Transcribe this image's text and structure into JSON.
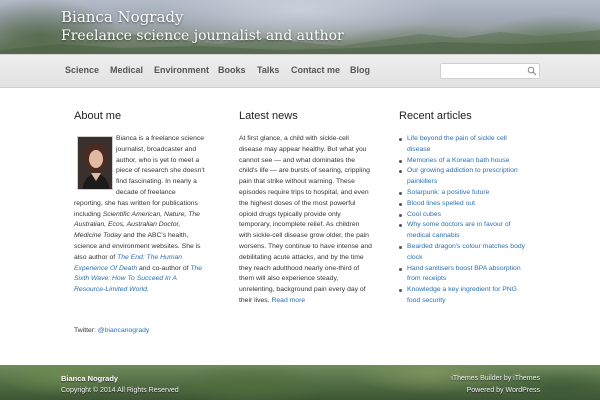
{
  "header": {
    "site_title": "Bianca Nogrady",
    "tagline": "Freelance science journalist and author"
  },
  "nav": {
    "items": [
      {
        "label": "Science"
      },
      {
        "label": "Medical"
      },
      {
        "label": "Environment"
      },
      {
        "label": "Books"
      },
      {
        "label": "Talks"
      },
      {
        "label": "Contact me"
      },
      {
        "label": "Blog"
      }
    ],
    "search": {
      "value": "",
      "placeholder": "",
      "icon": "search-icon"
    }
  },
  "about": {
    "title": "About me",
    "intro": "Bianca is a freelance science journalist, broadcaster and author, who is yet to meet a piece of research she doesn't find fascinating. In nearly a decade of freelance reporting, she has written for publications including ",
    "publications": "Scientific American, Nature, The Australian, Ecos, Australian Doctor, Medicine Today",
    "mid": " and the ABC's health, science and environment websites. She is also author of ",
    "book1": "The End: The Human Experience Of Death",
    "mid2": " and co-author of ",
    "book2": "The Sixth Wave: How To Succeed In A Resource-Limited World",
    "end": ".",
    "twitter_label": "Twitter: ",
    "twitter_handle": "@biancanogrady"
  },
  "news": {
    "title": "Latest news",
    "body": "At first glance, a child with sickle-cell disease may appear healthy. But what you cannot see — and what dominates the child's life — are bursts of searing, crippling pain that strike without warning. These episodes require trips to hospital, and even the highest doses of the most powerful opioid drugs typically provide only temporary, incomplete relief.  As children with sickle-cell disease grow older, the pain worsens. They continue to have intense and debilitating acute attacks, and by the time they reach adulthood nearly one-third of them will also experience steady, unrelenting, background pain every day of their lives. ",
    "read_more": "Read more"
  },
  "recent": {
    "title": "Recent articles",
    "items": [
      {
        "label": "Life beyond the pain of sickle cell disease"
      },
      {
        "label": "Memories of a Korean bath house"
      },
      {
        "label": "Our growing addiction to prescription painkillers"
      },
      {
        "label": "Solarpunk: a positive future"
      },
      {
        "label": "Blood lines spelled out"
      },
      {
        "label": "Cool cubes"
      },
      {
        "label": "Why some doctors are in favour of medical cannabis"
      },
      {
        "label": "Bearded dragon's colour matches body clock"
      },
      {
        "label": "Hand sanitisers boost BPA absorption from receipts"
      },
      {
        "label": "Knowledge a key ingredient for PNG food security"
      }
    ]
  },
  "footer": {
    "name": "Bianca Nogrady",
    "copyright": "Copyright © 2014 All Rights Reserved",
    "credit1": "iThemes Builder by iThemes",
    "credit2": "Powered by WordPress"
  },
  "colors": {
    "link": "#2a6fb5",
    "nav_bg": "#e6e6e6",
    "text": "#333333"
  }
}
